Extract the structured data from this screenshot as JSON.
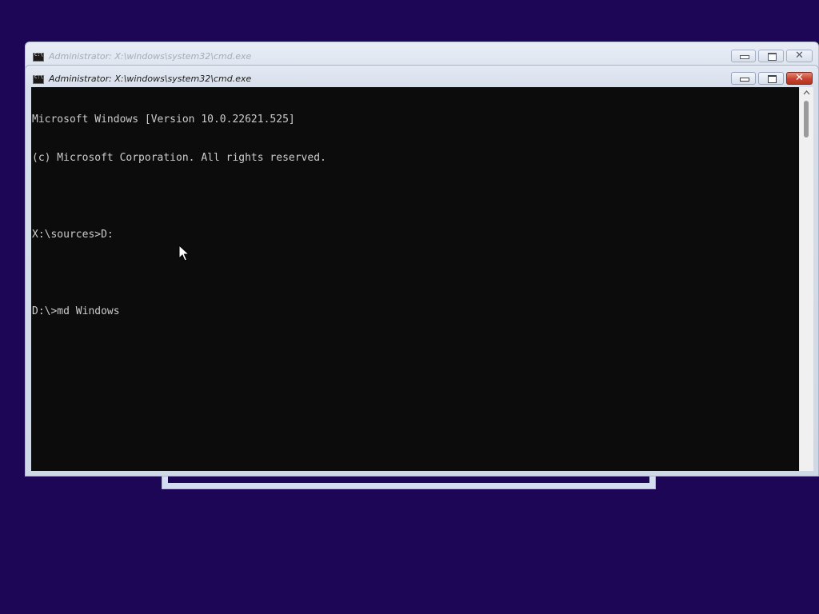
{
  "background_color": "#1e0657",
  "back_window": {
    "title": "Administrator: X:\\windows\\system32\\cmd.exe"
  },
  "front_window": {
    "title": "Administrator: X:\\windows\\system32\\cmd.exe",
    "close_color": "#c7432f"
  },
  "console": {
    "background": "#0c0c0c",
    "text_color": "#cccccc",
    "lines": [
      "Microsoft Windows [Version 10.0.22621.525]",
      "(c) Microsoft Corporation. All rights reserved.",
      "",
      "X:\\sources>D:",
      "",
      "D:\\>md Windows"
    ]
  },
  "icons": {
    "window_icon": "cmd-icon",
    "minimize": "minimize-icon",
    "maximize": "maximize-icon",
    "close": "close-icon",
    "cursor": "mouse-pointer-icon"
  }
}
